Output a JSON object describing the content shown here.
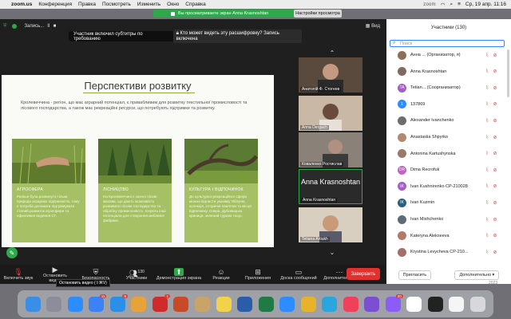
{
  "menubar": {
    "apple": "",
    "items": [
      "zoom.us",
      "Конференция",
      "Правка",
      "Посмотреть",
      "Изменить",
      "Окно",
      "Справка"
    ],
    "zoom_tag": "zoom",
    "clock": "Ср, 19 апр.  11:16"
  },
  "share_banner": {
    "text": "Вы просматриваете экран Anna Krasnoshtan",
    "options": "Настройки просмотра"
  },
  "topbar": {
    "recording": "Запись...",
    "pause": "II",
    "stop": "■",
    "view": "Вид"
  },
  "subs_notice": {
    "text": "Участник включил субтитры по требованию",
    "link": "Кто может видеть эту расшифровку? Запись включена"
  },
  "slide": {
    "title": "Перспективи розвитку",
    "intro": "Кролевеччина - регіон, що має аграрний потенціал, є привабливим для розвитку текстильної промисловості та лісового господарства, а також має рекреаційні ресурси, що потребують підтримки та розвитку.",
    "cards": [
      {
        "title": "АГРОСФЕРА",
        "text": "Раніше була розвинуто тільки природа аграрних підприємств, тому є потреба допомоги підтримувати сталий розвиток агросфери та ефективне ведення СГ."
      },
      {
        "title": "ЛІСНИЦТВО",
        "text": "На Кролевеччині є значні лісові масиви, що дають можливість розвивати лісове господарство та обробну промисловість. Існують інші потенціали для створення меблевої фабрики."
      },
      {
        "title": "КУЛЬТУРА І ВІДПОЧИНОК",
        "text": "До культурно-рекреаційної сфери можна віднести указівку Яблуню, колекція, історичні пам'ятки та місця відпочинку. Озера, Дубовицька криниця, зелений туризм тощо."
      }
    ]
  },
  "tiles": [
    {
      "name": "Анатолій Ф. Стогнов"
    },
    {
      "name": "Anna Dergach"
    },
    {
      "name": "Коваленко Ростислав"
    },
    {
      "name": "Anna Krasnoshtan",
      "big": "Anna Krasnoshtan"
    },
    {
      "name": "Tetiana Artiukh"
    }
  ],
  "toolbar": {
    "items": [
      "Включить звук",
      "Остановить видео",
      "Безопасность",
      "Участники",
      "Демонстрация экрана",
      "Реакции",
      "Приложения",
      "Доска сообщений",
      "Дополнительно"
    ],
    "tooltip": "Остановить видео (⇧⌘V)",
    "end": "Завершить",
    "participants_count": "130"
  },
  "panel": {
    "title": "Участники (130)",
    "search_placeholder": "Поиск",
    "participants": [
      {
        "name": "Анна ... (Организатор, я)",
        "initials": "",
        "color": "#8a6f5a"
      },
      {
        "name": "Anna Krasnoshtan",
        "initials": "",
        "color": "#7e6a60"
      },
      {
        "name": "Tetian... (Соорганизатор)",
        "initials": "TA",
        "color": "#a35fc4"
      },
      {
        "name": "137869",
        "initials": "1",
        "color": "#2d8cff"
      },
      {
        "name": "Alexander Ivanchenko",
        "initials": "",
        "color": "#6d6d6d"
      },
      {
        "name": "Anastasiia Shpyrko",
        "initials": "",
        "color": "#b08a70"
      },
      {
        "name": "Antonina Kartushynska",
        "initials": "",
        "color": "#9a7a66"
      },
      {
        "name": "Dima Recrofuk",
        "initials": "DR",
        "color": "#c45fc4"
      },
      {
        "name": "Ivan Kushnirenko CP-210028",
        "initials": "IK",
        "color": "#a35fc4"
      },
      {
        "name": "Ivan Kuzmin",
        "initials": "IK",
        "color": "#2c5f7a"
      },
      {
        "name": "Ivan Mishchenko",
        "initials": "",
        "color": "#5e6a77"
      },
      {
        "name": "Kateryna Alekseeva",
        "initials": "",
        "color": "#b07a6a"
      },
      {
        "name": "Krystina Levycheva CP-210...",
        "initials": "",
        "color": "#a26f6a"
      }
    ],
    "invite": "Пригласить",
    "more": "Дополнительно ▾"
  },
  "dock": {
    "icons": [
      {
        "name": "finder-icon",
        "color": "#3a8ee6",
        "badge": ""
      },
      {
        "name": "launchpad-icon",
        "color": "#8c8c9a",
        "badge": ""
      },
      {
        "name": "safari-icon",
        "color": "#2d8cff",
        "badge": ""
      },
      {
        "name": "mail-icon",
        "color": "#3b82f6",
        "badge": "11"
      },
      {
        "name": "app-store-icon",
        "color": "#2b8fe8",
        "badge": "9"
      },
      {
        "name": "photos-icon",
        "color": "#e8a23a",
        "badge": ""
      },
      {
        "name": "opera-icon",
        "color": "#d02a2a",
        "badge": "1"
      },
      {
        "name": "powerpoint-icon",
        "color": "#c94a26",
        "badge": ""
      },
      {
        "name": "preview-icon",
        "color": "#caa36a",
        "badge": ""
      },
      {
        "name": "notes-icon",
        "color": "#f2d24a",
        "badge": ""
      },
      {
        "name": "word-icon",
        "color": "#2b5caa",
        "badge": ""
      },
      {
        "name": "excel-icon",
        "color": "#1f7a44",
        "badge": ""
      },
      {
        "name": "zoom-icon",
        "color": "#2d8cff",
        "badge": ""
      },
      {
        "name": "chrome-icon",
        "color": "#e8b32a",
        "badge": ""
      },
      {
        "name": "telegram-icon",
        "color": "#2ba5e0",
        "badge": ""
      },
      {
        "name": "music-icon",
        "color": "#f0405a",
        "badge": ""
      },
      {
        "name": "viber-icon",
        "color": "#7b4fd1",
        "badge": ""
      },
      {
        "name": "messenger-icon",
        "color": "#8b5cf6",
        "badge": "20"
      },
      {
        "name": "calendar-icon",
        "color": "#ffffff",
        "badge": ""
      },
      {
        "name": "terminal-icon",
        "color": "#222222",
        "badge": ""
      },
      {
        "name": "textedit-icon",
        "color": "#f5f5f5",
        "badge": ""
      },
      {
        "name": "trash-icon",
        "color": "#d8d8dc",
        "badge": ""
      }
    ]
  }
}
